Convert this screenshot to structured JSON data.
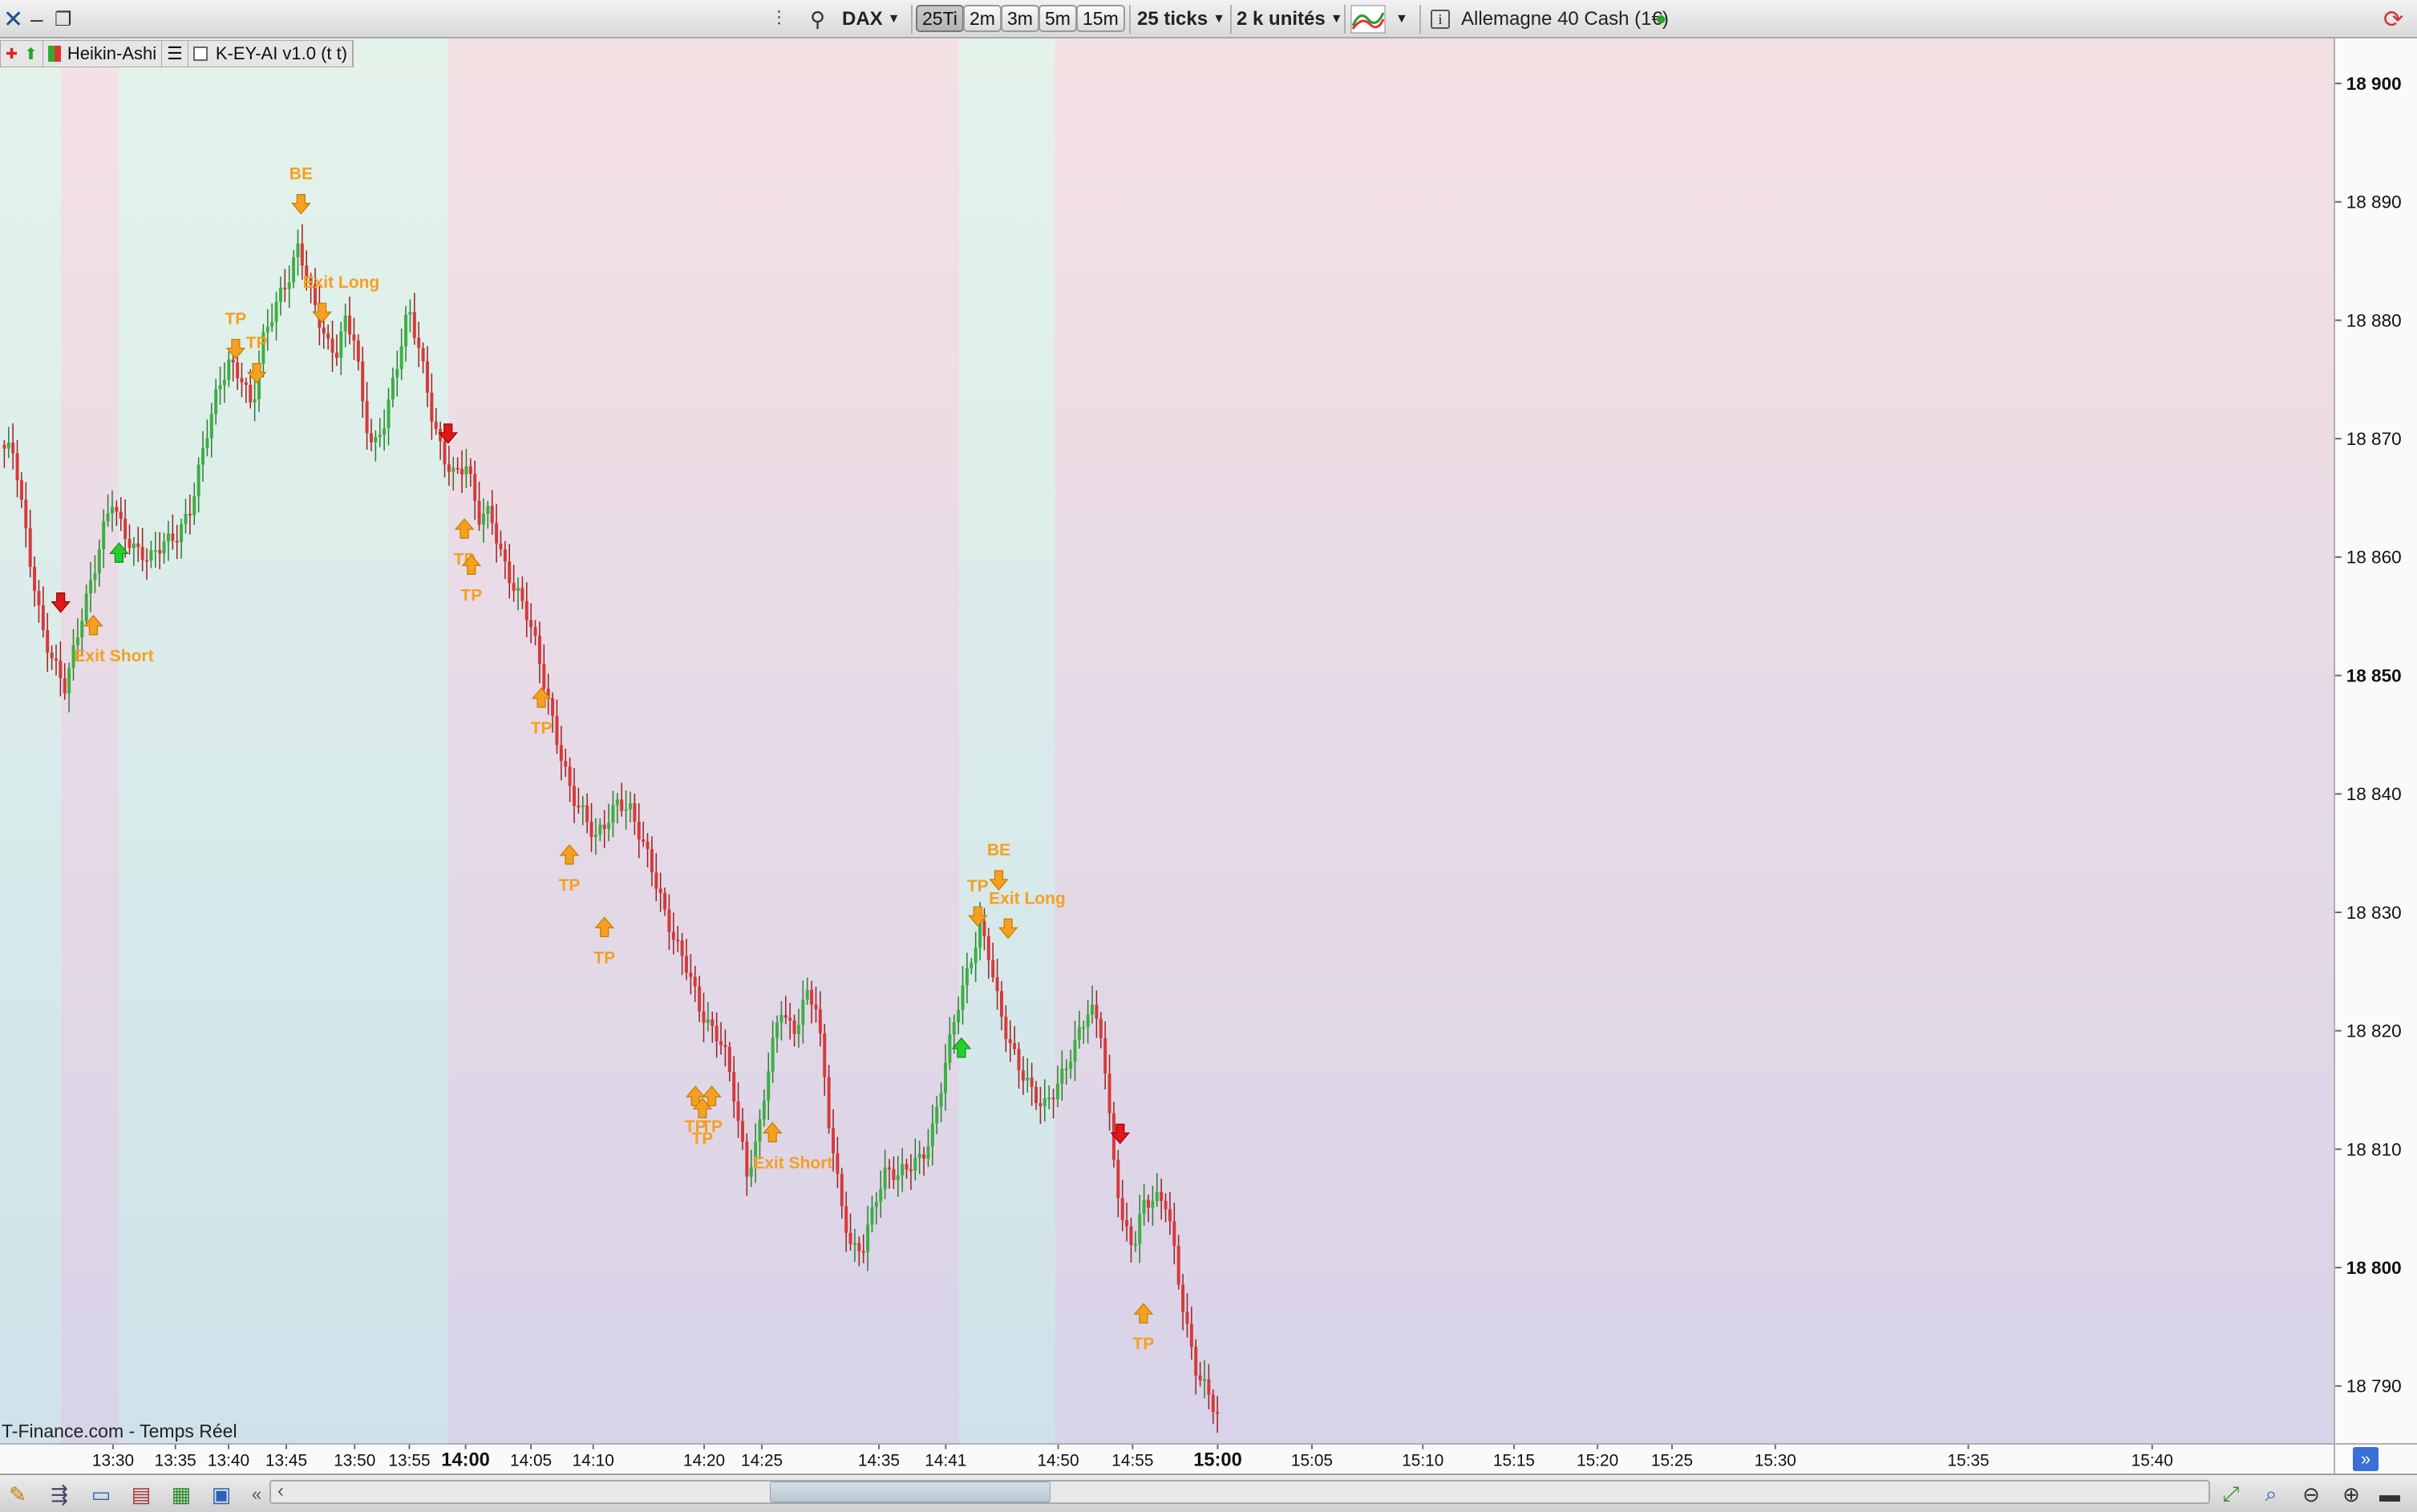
{
  "toolbar": {
    "instrument": "DAX",
    "timeframes": [
      "25Ti",
      "2m",
      "3m",
      "5m",
      "15m"
    ],
    "active_timeframe": "25Ti",
    "ticks_select": "25 ticks",
    "units_select": "2 k unités",
    "instrument_name": "Allemagne 40 Cash (1€)",
    "info_icon": "i"
  },
  "indicators": {
    "chart_type": "Heikin-Ashi",
    "indicator": "K-EY-AI v1.0 (t t)"
  },
  "footer": {
    "source": "T-Finance.com - Temps Réel"
  },
  "colors": {
    "bull": "#3cb043",
    "bear": "#d63a3a",
    "signal": "#f5a020",
    "green_zone": "#d8eee6",
    "red_zone": "#eadbe3"
  },
  "chart_data": {
    "type": "candlestick",
    "price_axis": {
      "ticks": [
        "18 900",
        "18 890",
        "18 880",
        "18 870",
        "18 860",
        "18 850",
        "18 840",
        "18 830",
        "18 820",
        "18 810",
        "18 800",
        "18 790"
      ],
      "bold": [
        "18 900",
        "18 850",
        "18 800"
      ]
    },
    "time_axis": {
      "labels": [
        "13:30",
        "13:35",
        "13:40",
        "13:45",
        "13:50",
        "13:55",
        "14:00",
        "14:05",
        "14:10",
        "14:20",
        "14:25",
        "14:35",
        "14:41",
        "14:50",
        "14:55",
        "15:00",
        "15:05",
        "15:10",
        "15:15",
        "15:20",
        "15:25",
        "15:30",
        "15:35",
        "15:40"
      ],
      "bold": [
        "14:00",
        "15:00"
      ]
    },
    "zones": [
      {
        "color": "green",
        "from": 0,
        "to": 0.026
      },
      {
        "color": "red",
        "from": 0.026,
        "to": 0.051
      },
      {
        "color": "green",
        "from": 0.051,
        "to": 0.192
      },
      {
        "color": "red",
        "from": 0.192,
        "to": 0.411
      },
      {
        "color": "green",
        "from": 0.411,
        "to": 0.452
      },
      {
        "color": "red",
        "from": 0.452,
        "to": 1
      }
    ],
    "price_path": [
      [
        0,
        18869
      ],
      [
        0.006,
        18868
      ],
      [
        0.012,
        18860
      ],
      [
        0.018,
        18854
      ],
      [
        0.024,
        18851
      ],
      [
        0.028,
        18849
      ],
      [
        0.032,
        18852
      ],
      [
        0.036,
        18855
      ],
      [
        0.04,
        18858
      ],
      [
        0.044,
        18862
      ],
      [
        0.048,
        18865
      ],
      [
        0.053,
        18862
      ],
      [
        0.058,
        18860
      ],
      [
        0.064,
        18859
      ],
      [
        0.07,
        18861
      ],
      [
        0.076,
        18862
      ],
      [
        0.082,
        18864
      ],
      [
        0.088,
        18869
      ],
      [
        0.093,
        18873
      ],
      [
        0.098,
        18876
      ],
      [
        0.104,
        18875
      ],
      [
        0.108,
        18872
      ],
      [
        0.112,
        18877
      ],
      [
        0.118,
        18880
      ],
      [
        0.124,
        18883
      ],
      [
        0.128,
        18886
      ],
      [
        0.132,
        18883
      ],
      [
        0.136,
        18880
      ],
      [
        0.14,
        18877
      ],
      [
        0.144,
        18876
      ],
      [
        0.148,
        18879
      ],
      [
        0.152,
        18878
      ],
      [
        0.156,
        18872
      ],
      [
        0.16,
        18869
      ],
      [
        0.165,
        18871
      ],
      [
        0.17,
        18875
      ],
      [
        0.175,
        18880
      ],
      [
        0.18,
        18877
      ],
      [
        0.185,
        18872
      ],
      [
        0.19,
        18868
      ],
      [
        0.195,
        18866
      ],
      [
        0.2,
        18867
      ],
      [
        0.205,
        18863
      ],
      [
        0.21,
        18864
      ],
      [
        0.215,
        18860
      ],
      [
        0.22,
        18857
      ],
      [
        0.225,
        18855
      ],
      [
        0.23,
        18852
      ],
      [
        0.235,
        18848
      ],
      [
        0.24,
        18844
      ],
      [
        0.245,
        18840
      ],
      [
        0.25,
        18838
      ],
      [
        0.255,
        18836
      ],
      [
        0.26,
        18838
      ],
      [
        0.265,
        18840
      ],
      [
        0.27,
        18839
      ],
      [
        0.275,
        18836
      ],
      [
        0.28,
        18833
      ],
      [
        0.285,
        18830
      ],
      [
        0.29,
        18828
      ],
      [
        0.295,
        18826
      ],
      [
        0.3,
        18822
      ],
      [
        0.305,
        18820
      ],
      [
        0.31,
        18819
      ],
      [
        0.315,
        18815
      ],
      [
        0.32,
        18809
      ],
      [
        0.325,
        18812
      ],
      [
        0.33,
        18818
      ],
      [
        0.335,
        18822
      ],
      [
        0.34,
        18820
      ],
      [
        0.345,
        18824
      ],
      [
        0.35,
        18823
      ],
      [
        0.355,
        18813
      ],
      [
        0.36,
        18806
      ],
      [
        0.365,
        18802
      ],
      [
        0.37,
        18803
      ],
      [
        0.375,
        18807
      ],
      [
        0.38,
        18809
      ],
      [
        0.385,
        18808
      ],
      [
        0.39,
        18809
      ],
      [
        0.395,
        18810
      ],
      [
        0.4,
        18813
      ],
      [
        0.405,
        18818
      ],
      [
        0.41,
        18822
      ],
      [
        0.415,
        18825
      ],
      [
        0.42,
        18829
      ],
      [
        0.424,
        18827
      ],
      [
        0.428,
        18823
      ],
      [
        0.432,
        18820
      ],
      [
        0.437,
        18817
      ],
      [
        0.442,
        18815
      ],
      [
        0.447,
        18814
      ],
      [
        0.452,
        18816
      ],
      [
        0.457,
        18818
      ],
      [
        0.462,
        18820
      ],
      [
        0.467,
        18822
      ],
      [
        0.472,
        18820
      ],
      [
        0.476,
        18812
      ],
      [
        0.481,
        18805
      ],
      [
        0.486,
        18803
      ],
      [
        0.49,
        18806
      ],
      [
        0.495,
        18806
      ],
      [
        0.5,
        18806
      ],
      [
        0.506,
        18799
      ],
      [
        0.512,
        18793
      ],
      [
        0.518,
        18790
      ],
      [
        0.522,
        18788
      ]
    ],
    "signals": [
      {
        "kind": "arrow-down",
        "color": "red",
        "t": 0.026,
        "p": 18856
      },
      {
        "kind": "arrow-up",
        "color": "orange",
        "t": 0.04,
        "p": 18854,
        "label": "Exit Short",
        "label_pos": "below"
      },
      {
        "kind": "arrow-up",
        "color": "green",
        "t": 0.051,
        "p": 18860
      },
      {
        "kind": "arrow-down",
        "color": "orange",
        "t": 0.101,
        "p": 18877,
        "label": "TP",
        "label_pos": "above"
      },
      {
        "kind": "arrow-down",
        "color": "orange",
        "t": 0.11,
        "p": 18875,
        "label": "TP",
        "label_pos": "above"
      },
      {
        "kind": "arrow-down",
        "color": "orange",
        "t": 0.129,
        "p": 18889,
        "label": "BE",
        "label_pos": "above"
      },
      {
        "kind": "arrow-down",
        "color": "orange",
        "t": 0.138,
        "p": 18880,
        "label": "Exit Long",
        "label_pos": "above"
      },
      {
        "kind": "arrow-down",
        "color": "red",
        "t": 0.192,
        "p": 18870
      },
      {
        "kind": "arrow-up",
        "color": "orange",
        "t": 0.199,
        "p": 18862,
        "label": "TP",
        "label_pos": "below"
      },
      {
        "kind": "arrow-up",
        "color": "orange",
        "t": 0.202,
        "p": 18859,
        "label": "TP",
        "label_pos": "below"
      },
      {
        "kind": "arrow-up",
        "color": "orange",
        "t": 0.232,
        "p": 18848,
        "label": "TP",
        "label_pos": "below"
      },
      {
        "kind": "arrow-up",
        "color": "orange",
        "t": 0.244,
        "p": 18835,
        "label": "TP",
        "label_pos": "below"
      },
      {
        "kind": "arrow-up",
        "color": "orange",
        "t": 0.259,
        "p": 18829,
        "label": "TP",
        "label_pos": "below"
      },
      {
        "kind": "arrow-up",
        "color": "orange",
        "t": 0.298,
        "p": 18815,
        "label": "TP",
        "label_pos": "below"
      },
      {
        "kind": "arrow-up",
        "color": "orange",
        "t": 0.301,
        "p": 18814,
        "label": "TP",
        "label_pos": "below"
      },
      {
        "kind": "arrow-up",
        "color": "orange",
        "t": 0.305,
        "p": 18815,
        "label": "TP",
        "label_pos": "below"
      },
      {
        "kind": "arrow-up",
        "color": "orange",
        "t": 0.331,
        "p": 18812,
        "label": "Exit Short",
        "label_pos": "below"
      },
      {
        "kind": "arrow-up",
        "color": "green",
        "t": 0.412,
        "p": 18819
      },
      {
        "kind": "arrow-down",
        "color": "orange",
        "t": 0.419,
        "p": 18830,
        "label": "TP",
        "label_pos": "above"
      },
      {
        "kind": "arrow-down",
        "color": "orange",
        "t": 0.428,
        "p": 18833,
        "label": "BE",
        "label_pos": "above"
      },
      {
        "kind": "arrow-down",
        "color": "orange",
        "t": 0.432,
        "p": 18829,
        "label": "Exit Long",
        "label_pos": "above"
      },
      {
        "kind": "arrow-down",
        "color": "red",
        "t": 0.48,
        "p": 18812
      },
      {
        "kind": "arrow-up",
        "color": "orange",
        "t": 0.49,
        "p": 18797,
        "label": "TP",
        "label_pos": "below"
      }
    ]
  }
}
